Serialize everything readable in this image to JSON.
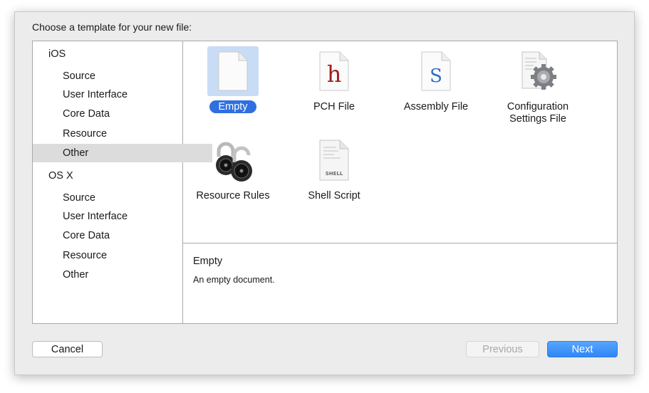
{
  "dialog": {
    "prompt": "Choose a template for your new file:"
  },
  "sidebar": {
    "items": [
      {
        "label": "iOS",
        "kind": "header"
      },
      {
        "label": "Source",
        "kind": "category"
      },
      {
        "label": "User Interface",
        "kind": "category"
      },
      {
        "label": "Core Data",
        "kind": "category"
      },
      {
        "label": "Resource",
        "kind": "category"
      },
      {
        "label": "Other",
        "kind": "category",
        "selected": true
      },
      {
        "label": "OS X",
        "kind": "header"
      },
      {
        "label": "Source",
        "kind": "category"
      },
      {
        "label": "User Interface",
        "kind": "category"
      },
      {
        "label": "Core Data",
        "kind": "category"
      },
      {
        "label": "Resource",
        "kind": "category"
      },
      {
        "label": "Other",
        "kind": "category"
      }
    ]
  },
  "templates": [
    {
      "label": "Empty",
      "icon": "empty-document-icon",
      "selected": true
    },
    {
      "label": "PCH File",
      "icon": "pch-file-icon",
      "glyph": "h",
      "glyph_color": "#a11c1c"
    },
    {
      "label": "Assembly File",
      "icon": "assembly-file-icon",
      "glyph": "S",
      "glyph_color": "#2f6fc6"
    },
    {
      "label": "Configuration\nSettings File",
      "icon": "configuration-settings-icon"
    },
    {
      "label": "Resource Rules",
      "icon": "padlocks-icon"
    },
    {
      "label": "Shell Script",
      "icon": "shell-script-icon",
      "glyph": "SHELL"
    }
  ],
  "description": {
    "title": "Empty",
    "text": "An empty document."
  },
  "buttons": {
    "cancel": "Cancel",
    "previous": "Previous",
    "next": "Next"
  },
  "colors": {
    "selection_blue": "#2f6fe0",
    "next_button": "#3a8ef8",
    "sidebar_selection": "#dcdcdc"
  }
}
